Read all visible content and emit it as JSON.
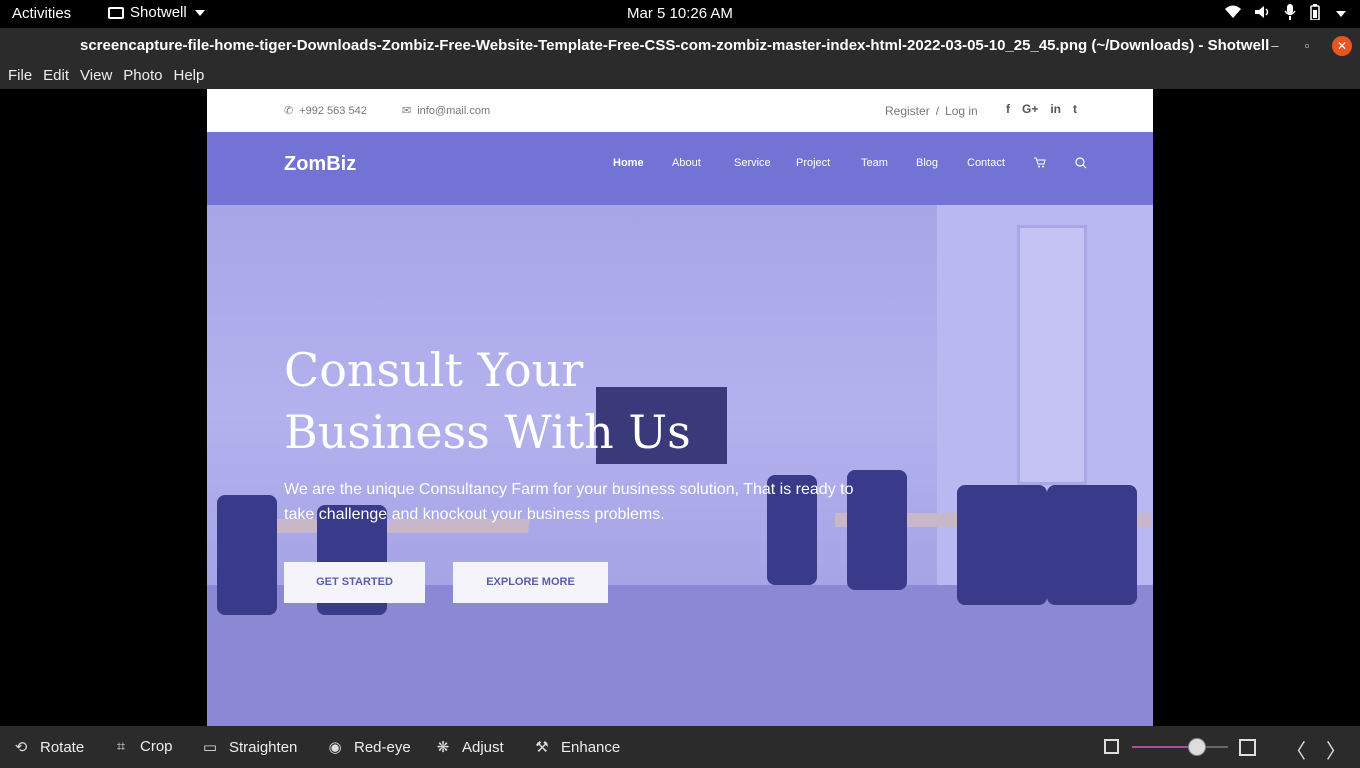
{
  "topbar": {
    "activities": "Activities",
    "app_name": "Shotwell",
    "clock": "Mar 5  10:26 AM",
    "tray_icons": [
      "wifi-icon",
      "volume-icon",
      "microphone-icon",
      "battery-icon",
      "system-menu-icon"
    ]
  },
  "window": {
    "title": "screencapture-file-home-tiger-Downloads-Zombiz-Free-Website-Template-Free-CSS-com-zombiz-master-index-html-2022-03-05-10_25_45.png (~/Downloads) - Shotwell",
    "minimize": "–",
    "restore": "▫",
    "close": "✕"
  },
  "menubar": [
    "File",
    "Edit",
    "View",
    "Photo",
    "Help"
  ],
  "site": {
    "phone": "+992 563 542",
    "email": "info@mail.com",
    "register": "Register",
    "separator": "/",
    "login": "Log in",
    "social": [
      "f",
      "G+",
      "in",
      "t"
    ],
    "logo": "ZomBiz",
    "nav": [
      "Home",
      "About",
      "Service",
      "Project",
      "Team",
      "Blog",
      "Contact"
    ],
    "hero_title_line1": "Consult Your",
    "hero_title_line2": "Business With Us",
    "hero_text": "We are the unique Consultancy Farm for your business solution, That is ready to take challenge and knockout your business problems.",
    "btn_primary": "GET STARTED",
    "btn_secondary": "EXPLORE MORE",
    "accent": "#7373d6"
  },
  "toolbar": {
    "rotate": "Rotate",
    "crop": "Crop",
    "straighten": "Straighten",
    "redeye": "Red-eye",
    "adjust": "Adjust",
    "enhance": "Enhance",
    "zoom_level": 0.68
  }
}
